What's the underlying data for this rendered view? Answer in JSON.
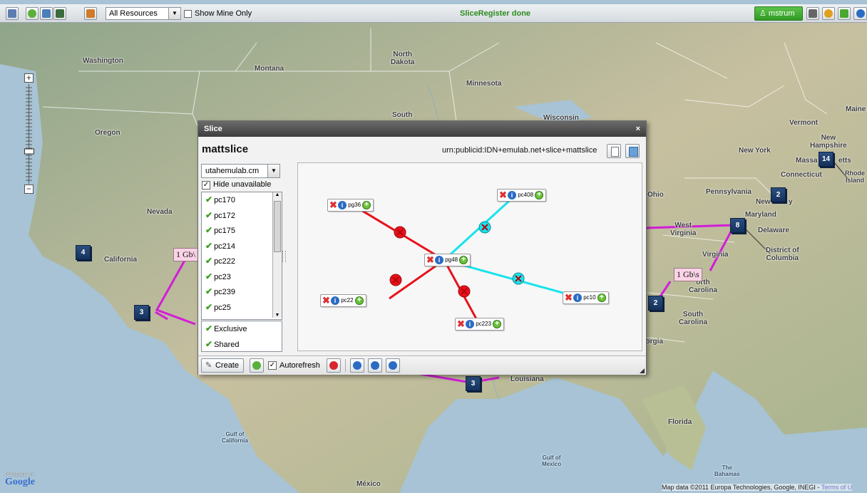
{
  "toolbar": {
    "resource_filter": "All Resources",
    "show_mine_label": "Show Mine Only",
    "status": "SliceRegister done",
    "user": "mstrum"
  },
  "map": {
    "labels": {
      "washington": "Washington",
      "montana": "Montana",
      "north_dakota": "North\nDakota",
      "minnesota": "Minnesota",
      "south": "South",
      "wisconsin": "Wisconsin",
      "oregon": "Oregon",
      "nevada": "Nevada",
      "california": "California",
      "vermont": "Vermont",
      "maine": "Maine",
      "new_hampshire": "New\nHampshire",
      "new_york": "New York",
      "massachusetts": "Massa",
      "massachusetts_end": "etts",
      "connecticut": "Connecticut",
      "rhode_island": "Rhode\nIsland",
      "ohio": "Ohio",
      "pennsylvania": "Pennsylvania",
      "new_jersey": "New",
      "new_jersey_end": "y",
      "maryland": "Maryland",
      "delaware": "Delaware",
      "west_virginia": "West\nVirginia",
      "virginia": "Virginia",
      "dc": "District of\nColumbia",
      "north_carolina": "orth\nCarolina",
      "south_carolina": "South\nCarolina",
      "georgia": "eorgia",
      "louisiana": "Louisiana",
      "florida": "Florida",
      "gulf_california": "Gulf of\nCalifornia",
      "gulf_mexico": "Gulf of\nMexico",
      "mexico": "México",
      "bahamas": "The\nBahamas"
    },
    "markers": {
      "m14": "14",
      "m2a": "2",
      "m8": "8",
      "m2b": "2",
      "m4": "4",
      "m3a": "3",
      "m3b": "3"
    },
    "link_labels": {
      "west": "1 Gb\\",
      "east": "1 Gb\\s"
    },
    "powered_by": "POWERED BY",
    "google": "Google",
    "copyright": "Map data ©2011  Europa Technologies, Google, INEGI - ",
    "terms": "Terms of U"
  },
  "dialog": {
    "title": "Slice",
    "close": "×",
    "slice_name": "mattslice",
    "urn": "urn:publicid:IDN+emulab.net+slice+mattslice",
    "manager": "utahemulab.cm",
    "hide_unavailable": "Hide unavailable",
    "nodes": [
      "pc170",
      "pc172",
      "pc175",
      "pc214",
      "pc222",
      "pc23",
      "pc239",
      "pc25"
    ],
    "options": [
      "Exclusive",
      "Shared"
    ],
    "create_label": "Create",
    "autorefresh_label": "Autorefresh",
    "topology_nodes": {
      "pg36": "pg36",
      "pc408": "pc408",
      "pg48": "pg48",
      "pc22": "pc22",
      "pc10": "pc10",
      "pc223": "pc223"
    }
  },
  "colors": {
    "link_red": "#e8121b",
    "link_cyan": "#18e3ee",
    "map_link": "#d21dd8",
    "status_green": "#2e8b1f"
  }
}
